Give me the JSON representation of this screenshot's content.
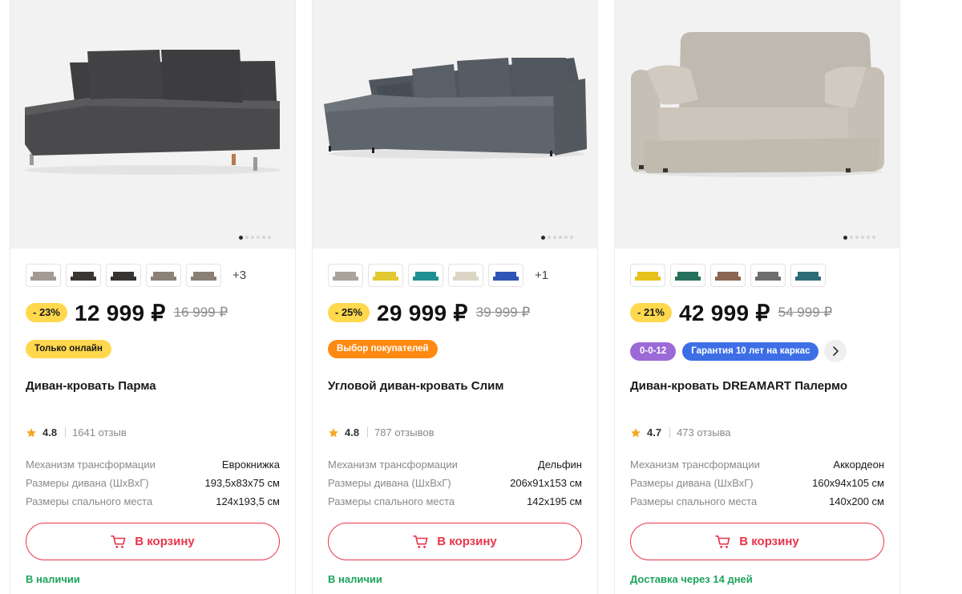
{
  "products": [
    {
      "name": "Диван-кровать Парма",
      "discount": "- 23%",
      "price": "12 999 ₽",
      "old_price": "16 999 ₽",
      "color_swatches": [
        "#a39a92",
        "#3a3634",
        "#363433",
        "#8c8275",
        "#8a7f74"
      ],
      "more_colors": "+3",
      "badges": [
        {
          "text": "Только онлайн",
          "style": "yellow"
        }
      ],
      "rating": "4.8",
      "reviews": "1641 отзыв",
      "specs": [
        {
          "label": "Механизм трансформации",
          "value": "Еврокнижка"
        },
        {
          "label": "Размеры дивана (ШхВхГ)",
          "value": "193,5x83x75 см"
        },
        {
          "label": "Размеры спального места",
          "value": "124x193,5 см"
        }
      ],
      "cart_label": "В корзину",
      "availability": "В наличии",
      "image_slide": 1,
      "image_slides_total": 6,
      "sofa_color": "#4a4a4c"
    },
    {
      "name": "Угловой диван-кровать Слим",
      "discount": "- 25%",
      "price": "29 999 ₽",
      "old_price": "39 999 ₽",
      "color_swatches": [
        "#a8a39b",
        "#e2c92f",
        "#1f8f92",
        "#ddd5c4",
        "#2f55b7"
      ],
      "more_colors": "+1",
      "badges": [
        {
          "text": "Выбор покупателей",
          "style": "orange"
        }
      ],
      "rating": "4.8",
      "reviews": "787 отзывов",
      "specs": [
        {
          "label": "Механизм трансформации",
          "value": "Дельфин"
        },
        {
          "label": "Размеры дивана (ШхВхГ)",
          "value": "206x91x153 см"
        },
        {
          "label": "Размеры спального места",
          "value": "142x195 см"
        }
      ],
      "cart_label": "В корзину",
      "availability": "В наличии",
      "image_slide": 1,
      "image_slides_total": 6,
      "sofa_color": "#5f656c"
    },
    {
      "name": "Диван-кровать DREAMART Палермо",
      "discount": "- 21%",
      "price": "42 999 ₽",
      "old_price": "54 999 ₽",
      "color_swatches": [
        "#e5c21b",
        "#24705d",
        "#8c6552",
        "#6e6e6e",
        "#2e6c78"
      ],
      "more_colors": "",
      "badges": [
        {
          "text": "0-0-12",
          "style": "purple"
        },
        {
          "text": "Гарантия 10 лет на каркас",
          "style": "blue"
        }
      ],
      "rating": "4.7",
      "reviews": "473 отзыва",
      "specs": [
        {
          "label": "Механизм трансформации",
          "value": "Аккордеон"
        },
        {
          "label": "Размеры дивана (ШхВхГ)",
          "value": "160x94x105 см"
        },
        {
          "label": "Размеры спального места",
          "value": "140x200 см"
        }
      ],
      "cart_label": "В корзину",
      "availability": "Доставка через 14 дней",
      "image_slide": 1,
      "image_slides_total": 6,
      "sofa_color": "#c5bfb5"
    }
  ],
  "colors": {
    "accent": "#e8354b",
    "in_stock": "#1ba35a",
    "discount_badge": "#ffd84d",
    "rating_star": "#f5a623"
  },
  "icons": {
    "cart": "cart-icon",
    "star": "star-icon",
    "next": "chevron-right-icon"
  }
}
